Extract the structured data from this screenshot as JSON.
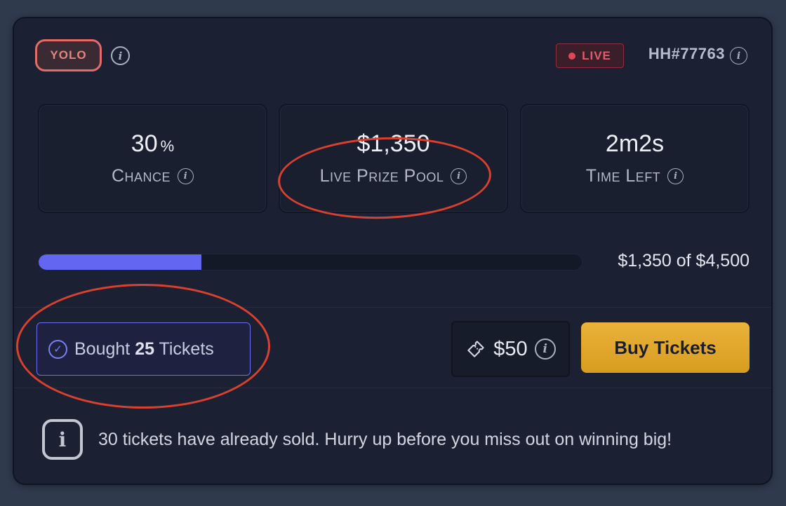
{
  "header": {
    "mode_badge": "YOLO",
    "live_label": "LIVE",
    "game_id": "HH#77763"
  },
  "stats": {
    "chance": {
      "value": "30",
      "unit": "%",
      "label": "Chance"
    },
    "prize_pool": {
      "value": "$1,350",
      "label": "Live Prize Pool"
    },
    "time_left": {
      "value": "2m2s",
      "label": "Time Left"
    }
  },
  "progress": {
    "raised": 1350,
    "goal": 4500,
    "fraction": 0.3,
    "text": "$1,350 of $4,500"
  },
  "actions": {
    "bought_prefix": "Bought",
    "bought_count": "25",
    "bought_suffix": "Tickets",
    "ticket_price": "$50",
    "buy_button_label": "Buy Tickets"
  },
  "notice": {
    "text": "30 tickets have already sold. Hurry up before you miss out on winning big!"
  },
  "colors": {
    "accent": "#6366f1",
    "buy_button": "#e0a82e",
    "live": "#e05b6c",
    "annotation": "#d9402e"
  },
  "icons": {
    "info": "info-circle-icon",
    "check": "check-circle-icon",
    "ticket": "ticket-icon",
    "notice": "info-square-icon",
    "live": "live-dot-icon"
  }
}
